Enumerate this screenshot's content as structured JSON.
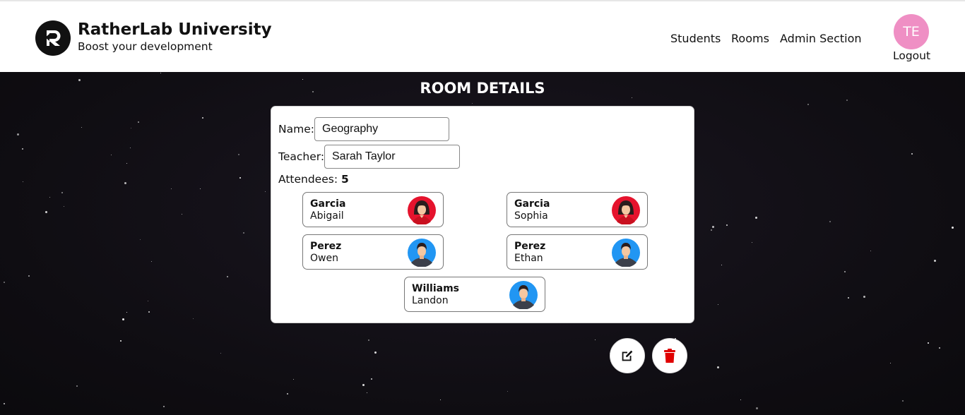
{
  "header": {
    "brand_title": "RatherLab University",
    "brand_subtitle": "Boost your development",
    "nav": [
      {
        "label": "Students"
      },
      {
        "label": "Rooms"
      },
      {
        "label": "Admin Section"
      }
    ],
    "avatar_initials": "TE",
    "logout_label": "Logout"
  },
  "page": {
    "title": "ROOM DETAILS"
  },
  "room": {
    "name_label": "Name:",
    "name_value": "Geography",
    "teacher_label": "Teacher:",
    "teacher_value": "Sarah Taylor",
    "attendees_label": "Attendees:",
    "attendees_count": "5"
  },
  "students": [
    {
      "last": "Garcia",
      "first": "Abigail",
      "avatar": "female-avatar-icon"
    },
    {
      "last": "Garcia",
      "first": "Sophia",
      "avatar": "female-avatar-icon"
    },
    {
      "last": "Perez",
      "first": "Owen",
      "avatar": "male-avatar-icon"
    },
    {
      "last": "Perez",
      "first": "Ethan",
      "avatar": "male-avatar-icon"
    },
    {
      "last": "Williams",
      "first": "Landon",
      "avatar": "male-avatar-icon"
    }
  ],
  "actions": {
    "edit_icon": "edit-icon",
    "delete_icon": "trash-icon"
  },
  "colors": {
    "avatar_bg": "#ef8fc4",
    "female_avatar_bg": "#e5132d",
    "male_avatar_bg": "#2196f3",
    "delete_red": "#e00000"
  }
}
